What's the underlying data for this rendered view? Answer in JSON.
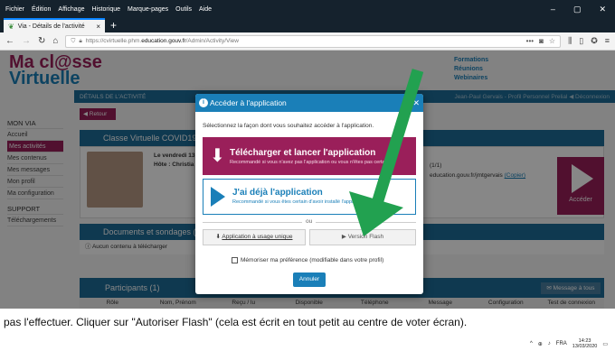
{
  "browser": {
    "menu": [
      "Fichier",
      "Édition",
      "Affichage",
      "Historique",
      "Marque-pages",
      "Outils",
      "Aide"
    ],
    "window_controls": [
      "–",
      "▢",
      "✕"
    ],
    "tab_title": "Via - Détails de l'activité",
    "url_prefix": "https://cvirtuelle.phm.",
    "url_host": "education.gouv.fr",
    "url_path": "/Admin/Activity/View",
    "url_more": "•••"
  },
  "site": {
    "logo_line1": "Ma cl@sse",
    "logo_line2": "Virtuelle",
    "top_links": [
      "Formations",
      "Réunions",
      "Webinaires"
    ],
    "breadcrumb": "DÉTAILS DE L'ACTIVITÉ",
    "user_text": "Jean-Paul Gervais - Profil Personnel Prelial ◀ Déconnexion",
    "sidebar": {
      "header1": "MON VIA",
      "items1": [
        "Accueil",
        "Mes activités",
        "Mes contenus",
        "Mes messages",
        "Mon profil",
        "Ma configuration"
      ],
      "header2": "SUPPORT",
      "items2": [
        "Téléchargements"
      ]
    },
    "back_label": "◀ Retour",
    "classroom_title": "Classe Virtuelle COVID19",
    "classroom_date": "Le vendredi 13",
    "classroom_host": "Hôte : Christia",
    "right_count": "(1/1)",
    "right_mail": "education.gouv.fr/jmtgervais",
    "right_copy": "(Copier)",
    "acceder_label": "Accéder",
    "docs_title": "Documents et sondages (",
    "docs_empty": "Aucun contenu à télécharger",
    "participants_title": "Participants (1)",
    "message_all": "✉ Message à tous",
    "columns": [
      "Rôle",
      "Nom, Prénom",
      "Reçu / lu",
      "Disponible",
      "Téléphone",
      "Message",
      "Configuration",
      "Test de connexion"
    ]
  },
  "modal": {
    "title": "Accéder à l'application",
    "close": "✕",
    "description": "Sélectionnez la façon dont vous souhaitez accéder à l'application.",
    "download_title": "Télécharger et lancer l'application",
    "download_sub": "Recommandé si vous n'avez pas l'application ou vous n'êtes pas certain",
    "have_title": "J'ai déjà l'application",
    "have_sub": "Recommandé si vous êtes certain d'avoir installé l'application",
    "or": "ou",
    "single_use": "Application à usage unique",
    "flash": "Version Flash",
    "remember": "Mémoriser ma préférence (modifiable dans votre profil)",
    "cancel": "Annuler"
  },
  "caption": "pas l'effectuer. Cliquer sur \"Autoriser Flash\" (cela est écrit en tout petit au centre de voter écran).",
  "taskbar": {
    "lang": "FRA",
    "time": "14:23",
    "date": "13/03/2020"
  },
  "colors": {
    "brand_magenta": "#9a1f5a",
    "brand_blue": "#1a7fb8",
    "arrow_green": "#22a150"
  }
}
